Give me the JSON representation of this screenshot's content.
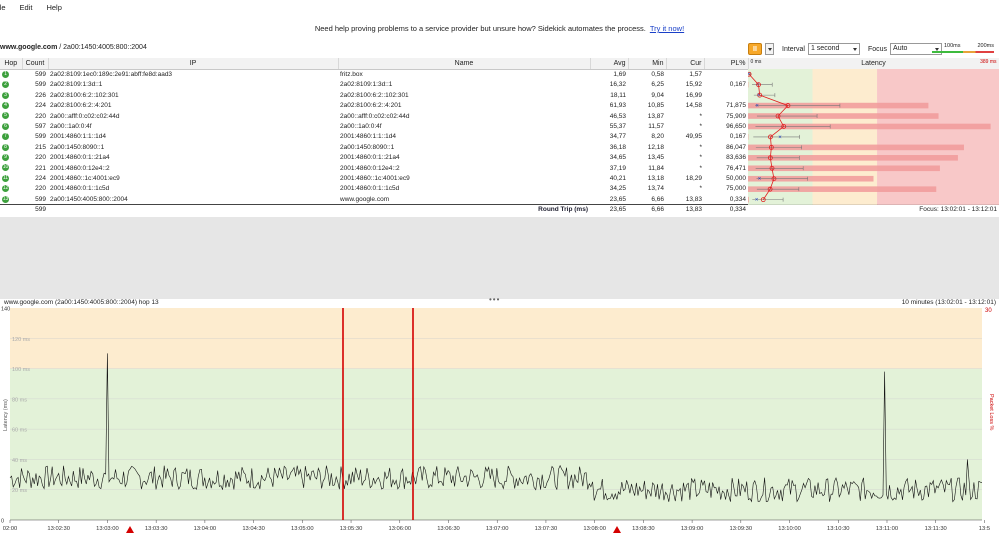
{
  "menu": [
    "ile",
    "Edit",
    "Help"
  ],
  "banner": {
    "text": "Need help proving problems to a service provider but unsure how? Sidekick automates the process.",
    "link": "Try it now!"
  },
  "target": {
    "host": "www.google.com",
    "path": " / 2a00:1450:4005:800::2004"
  },
  "controls": {
    "pause_label": "II",
    "interval_label": "Interval",
    "interval_value": "1 second",
    "focus_label": "Focus",
    "focus_value": "Auto",
    "legend_100": "100ms",
    "legend_200": "200ms"
  },
  "table": {
    "headers": {
      "hop": "Hop",
      "count": "Count",
      "ip": "IP",
      "name": "Name",
      "avg": "Avg",
      "min": "Min",
      "cur": "Cur",
      "pl": "PL%",
      "latency": "Latency"
    },
    "latency_scale": {
      "start": "0 ms",
      "end": "389 ms"
    },
    "rows": [
      {
        "hop": "1",
        "count": "599",
        "ip": "2a02:8109:1ec0:189c:2e91:abff:fe8d:aad3",
        "name": "fritz.box",
        "avg": "1,69",
        "min": "0,58",
        "cur": "1,57",
        "pl": ""
      },
      {
        "hop": "2",
        "count": "599",
        "ip": "2a02:8109:1:3d::1",
        "name": "2a02:8109:1:3d::1",
        "avg": "16,32",
        "min": "6,25",
        "cur": "15,92",
        "pl": "0,167"
      },
      {
        "hop": "3",
        "count": "226",
        "ip": "2a02:8100:6:2::102:301",
        "name": "2a02:8100:6:2::102:301",
        "avg": "18,11",
        "min": "9,04",
        "cur": "16,99",
        "pl": ""
      },
      {
        "hop": "4",
        "count": "224",
        "ip": "2a02:8100:6:2::4:201",
        "name": "2a02:8100:6:2::4:201",
        "avg": "61,93",
        "min": "10,85",
        "cur": "14,58",
        "pl": "71,875"
      },
      {
        "hop": "5",
        "count": "220",
        "ip": "2a00::afff:0:c02:c02:44d",
        "name": "2a00::afff:0:c02:c02:44d",
        "avg": "46,53",
        "min": "13,87",
        "cur": "*",
        "pl": "75,909"
      },
      {
        "hop": "6",
        "count": "597",
        "ip": "2a00::1a0:0:4f",
        "name": "2a00::1a0:0:4f",
        "avg": "55,37",
        "min": "11,57",
        "cur": "*",
        "pl": "96,650"
      },
      {
        "hop": "7",
        "count": "599",
        "ip": "2001:4860:1:1::1d4",
        "name": "2001:4860:1:1::1d4",
        "avg": "34,77",
        "min": "8,20",
        "cur": "49,95",
        "pl": "0,167"
      },
      {
        "hop": "8",
        "count": "215",
        "ip": "2a00:1450:8090::1",
        "name": "2a00:1450:8090::1",
        "avg": "36,18",
        "min": "12,18",
        "cur": "*",
        "pl": "86,047"
      },
      {
        "hop": "9",
        "count": "220",
        "ip": "2001:4860:0:1::21a4",
        "name": "2001:4860:0:1::21a4",
        "avg": "34,65",
        "min": "13,45",
        "cur": "*",
        "pl": "83,636"
      },
      {
        "hop": "10",
        "count": "221",
        "ip": "2001:4860:0:12e4::2",
        "name": "2001:4860:0:12e4::2",
        "avg": "37,19",
        "min": "11,84",
        "cur": "*",
        "pl": "76,471"
      },
      {
        "hop": "11",
        "count": "224",
        "ip": "2001:4860::1c:4001:ec9",
        "name": "2001:4860::1c:4001:ec9",
        "avg": "40,21",
        "min": "13,18",
        "cur": "18,29",
        "pl": "50,000"
      },
      {
        "hop": "12",
        "count": "220",
        "ip": "2001:4860:0:1::1c5d",
        "name": "2001:4860:0:1::1c5d",
        "avg": "34,25",
        "min": "13,74",
        "cur": "*",
        "pl": "75,000"
      },
      {
        "hop": "13",
        "count": "599",
        "ip": "2a00:1450:4005:800::2004",
        "name": "www.google.com",
        "avg": "23,65",
        "min": "6,66",
        "cur": "13,83",
        "pl": "0,334"
      }
    ],
    "summary": {
      "count": "599",
      "label": "Round Trip (ms)",
      "avg": "23,65",
      "min": "6,66",
      "cur": "13,83",
      "pl": "0,334",
      "focus": "Focus: 13:02:01 - 13:12:01"
    }
  },
  "graph": {
    "title": "www.google.com (2a00:1450:4005:800::2004) hop 13",
    "range": "10 minutes (13:02:01 - 13:12:01)",
    "ylabel": "Latency (ms)",
    "y2label": "Packet Loss %",
    "y_ticks": [
      "140",
      "120 ms",
      "100 ms",
      "80 ms",
      "60 ms",
      "40 ms",
      "20 ms",
      "0"
    ],
    "y2_top": "30",
    "x_ticks": [
      "02:00",
      "13:02:30",
      "13:03:00",
      "13:03:30",
      "13:04:00",
      "13:04:30",
      "13:05:00",
      "13:05:30",
      "13:06:00",
      "13:06:30",
      "13:07:00",
      "13:07:30",
      "13:08:00",
      "13:08:30",
      "13:09:00",
      "13:09:30",
      "13:10:00",
      "13:10:30",
      "13:11:00",
      "13:11:30",
      "13:5"
    ]
  },
  "colors": {
    "good": "#e3f2d8",
    "warn": "#fdeccf",
    "bad": "#f8c8c8",
    "marker": "#d40000",
    "hop_badge": "#3da03d",
    "accent_link": "#1a40c8"
  }
}
